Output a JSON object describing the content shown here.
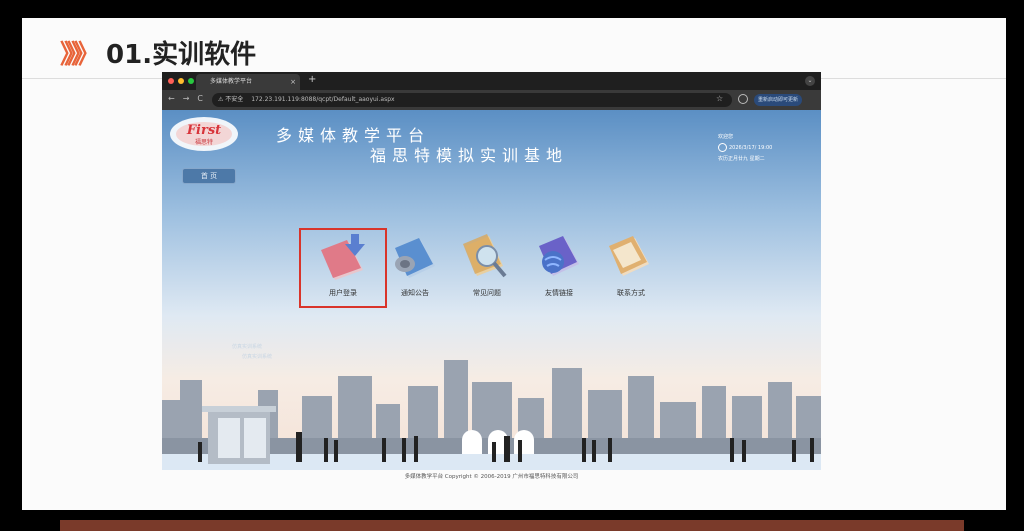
{
  "slide": {
    "chevrons": "》》》",
    "title": "01.实训软件"
  },
  "browser": {
    "tab_title": "多媒体教学平台",
    "tab_close": "×",
    "new_tab": "+",
    "tab_menu": "⌄",
    "nav_back": "←",
    "nav_forward": "→",
    "nav_reload": "C",
    "security_label": "⚠ 不安全",
    "url": "172.23.191.119:8088/qcpt/Default_aaoyui.aspx",
    "star": "☆",
    "relaunch_label": "重新启动即可更新"
  },
  "site": {
    "logo_text": "First",
    "logo_sub": "福思特",
    "header_line1": "多媒体教学平台",
    "header_line2": "福思特模拟实训基地",
    "home_label": "首 页",
    "welcome": "欢迎您",
    "datetime": "2026/3/17/ 19:00",
    "lunar": "农历正月廿九 星期二",
    "ghost_line1": "仿真实训系统",
    "ghost_line2": "仿真实训系统",
    "menu": [
      {
        "label": "用户登录",
        "icon": "user-login-icon",
        "color": "#e07a88"
      },
      {
        "label": "通知公告",
        "icon": "announcement-icon",
        "color": "#5a8fd0"
      },
      {
        "label": "常见问题",
        "icon": "faq-icon",
        "color": "#d9a65a"
      },
      {
        "label": "友情链接",
        "icon": "friendly-links-icon",
        "color": "#6a62c8"
      },
      {
        "label": "联系方式",
        "icon": "contact-icon",
        "color": "#e0b070"
      }
    ],
    "footer": "多媒体教学平台 Copyright © 2006-2019 广州市福思特科技有限公司"
  },
  "colors": {
    "accent_chevron": "#e8643a",
    "highlight_box": "#d9342a"
  }
}
